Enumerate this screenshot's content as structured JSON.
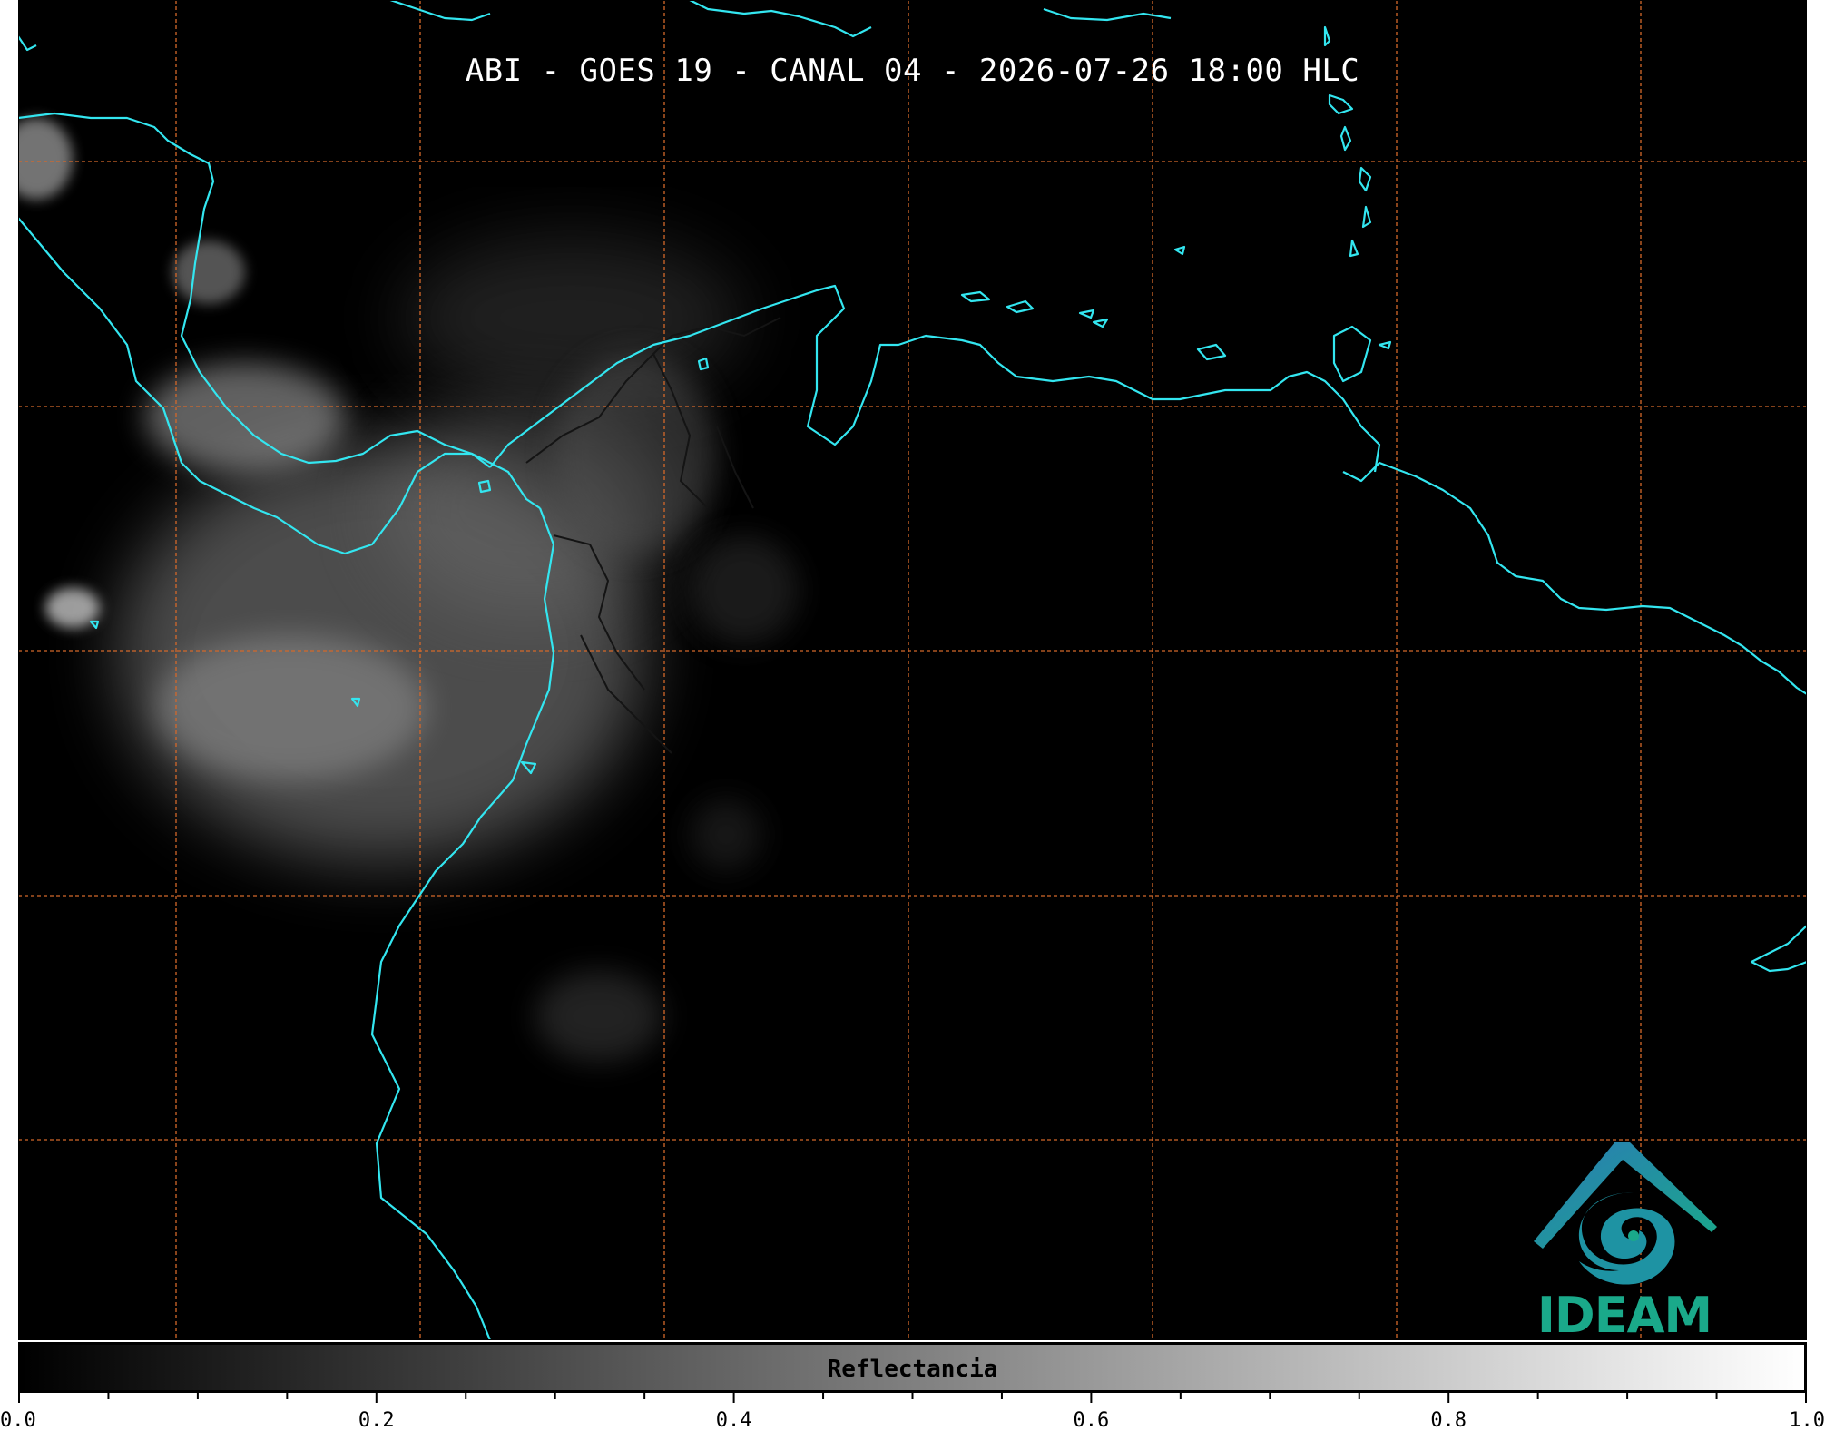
{
  "map": {
    "title": "ABI - GOES 19 - CANAL 04 - 2026-07-26 18:00 HLC",
    "colors": {
      "background": "#000000",
      "coastline": "#33e6f0",
      "grid": "#d4682a",
      "borders": "#111111",
      "cloud": "#cfcfcf"
    },
    "gridlines": true
  },
  "logo": {
    "text": "IDEAM",
    "icon": "ideam-mountain-swirl-icon",
    "colors": {
      "text": "#1aa98a",
      "mountain": "#2a7bb5",
      "swirl": "#1aa98a"
    }
  },
  "colorbar": {
    "label": "Reflectancia",
    "min": 0.0,
    "max": 1.0,
    "ticks": [
      "0.0",
      "0.2",
      "0.4",
      "0.6",
      "0.8",
      "1.0"
    ],
    "tick_values": [
      0.0,
      0.2,
      0.4,
      0.6,
      0.8,
      1.0
    ],
    "minor_tick_step": 0.05,
    "colormap": [
      "#000000",
      "#ffffff"
    ]
  }
}
